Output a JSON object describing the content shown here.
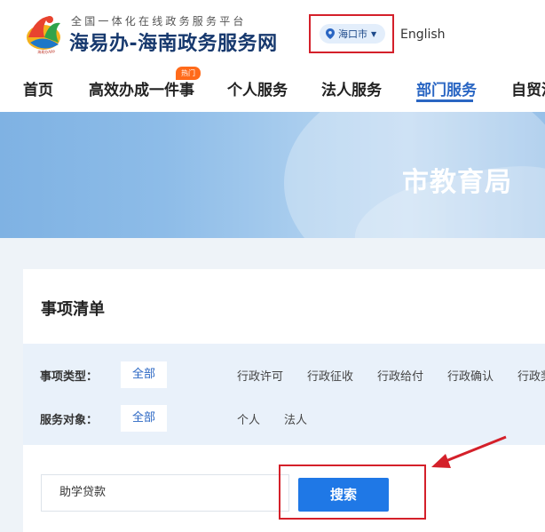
{
  "header": {
    "tagline": "全国一体化在线政务服务平台",
    "site_title": "海易办-海南政务服务网",
    "logo_caption": "海易办APP",
    "city": "海口市",
    "language": "English"
  },
  "nav": {
    "items": [
      {
        "label": "首页"
      },
      {
        "label": "高效办成一件事"
      },
      {
        "label": "个人服务"
      },
      {
        "label": "法人服务"
      },
      {
        "label": "部门服务"
      },
      {
        "label": "自贸港"
      }
    ],
    "active": "部门服务",
    "hot_badge": "热门"
  },
  "banner": {
    "title": "市教育局"
  },
  "card": {
    "title": "事项清单",
    "filters": {
      "type_label": "事项类型：",
      "type_all": "全部",
      "type_options": [
        "行政许可",
        "行政征收",
        "行政给付",
        "行政确认",
        "行政奖"
      ],
      "target_label": "服务对象：",
      "target_all": "全部",
      "target_options": [
        "个人",
        "法人"
      ]
    },
    "search": {
      "value": "助学贷款",
      "button": "搜索"
    }
  },
  "colors": {
    "brand_blue": "#2a66c3",
    "button_blue": "#1f78e6",
    "highlight_red": "#d4202a",
    "title_navy": "#17396e"
  }
}
